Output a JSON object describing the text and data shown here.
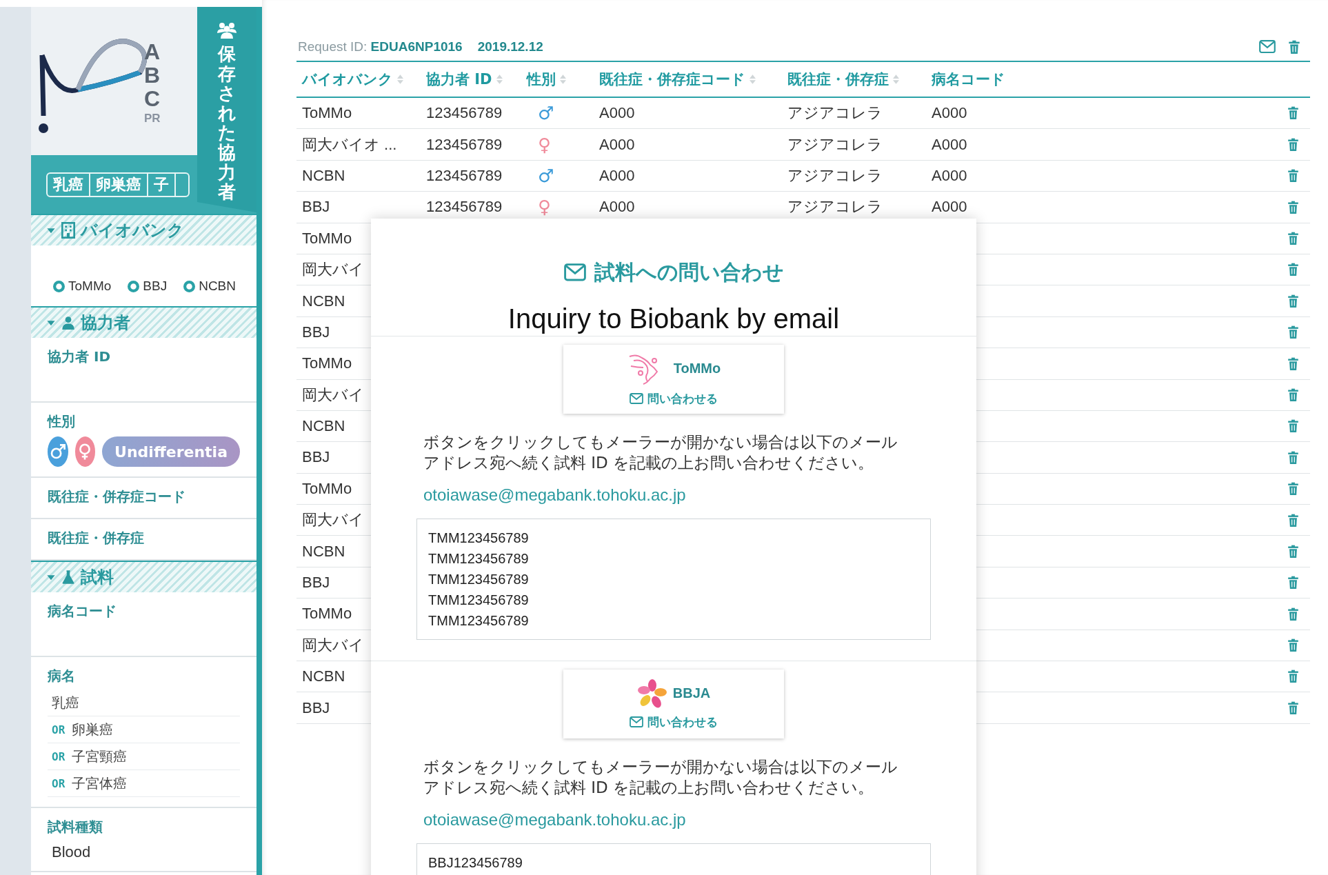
{
  "sidebar": {
    "logo_letters": [
      "A",
      "B",
      "C",
      "PR"
    ],
    "disease_tabs": [
      {
        "label": "乳癌"
      },
      {
        "label": "卵巣癌"
      },
      {
        "label": "子"
      }
    ],
    "sections": [
      {
        "title": "バイオバンク",
        "expanded": true,
        "fields": [
          {
            "kind": "chips",
            "options": [
              {
                "label": "ToMMo",
                "checked": true
              },
              {
                "label": "BBJ",
                "checked": true
              },
              {
                "label": "NCBN",
                "checked": true
              }
            ]
          }
        ]
      },
      {
        "title": "協力者",
        "expanded": true,
        "fields": [
          {
            "kind": "label",
            "label": "協力者 ID"
          },
          {
            "kind": "gender",
            "label": "性別",
            "options": [
              {
                "kind": "male"
              },
              {
                "kind": "female"
              },
              {
                "kind": "other",
                "label": "Undifferentia"
              }
            ]
          },
          {
            "kind": "label",
            "label": "既往症・併存症コード"
          },
          {
            "kind": "label",
            "label": "既往症・併存症"
          }
        ]
      },
      {
        "title": "試料",
        "expanded": true,
        "fields": [
          {
            "kind": "label",
            "label": "病名コード"
          },
          {
            "kind": "list",
            "label": "病名",
            "items": [
              {
                "text": "乳癌"
              },
              {
                "operator": "OR",
                "text": "卵巣癌"
              },
              {
                "operator": "OR",
                "text": "子宮頸癌"
              },
              {
                "operator": "OR",
                "text": "子宮体癌"
              }
            ]
          },
          {
            "kind": "value",
            "label": "試料種類",
            "value": "Blood"
          }
        ]
      }
    ]
  },
  "saved_tab": {
    "label": "保存された協力者"
  },
  "request": {
    "label": "Request ID:",
    "id": "EDUA6NP1016",
    "date": "2019.12.12"
  },
  "table": {
    "columns": [
      {
        "label": "バイオバンク",
        "sortable": true
      },
      {
        "label": "協力者 ID",
        "sortable": true
      },
      {
        "label": "性別",
        "sortable": true
      },
      {
        "label": "既往症・併存症コード",
        "sortable": true
      },
      {
        "label": "既往症・併存症",
        "sortable": true
      },
      {
        "label": "病名コード",
        "sortable": false
      }
    ],
    "rows": [
      {
        "biobank": "ToMMo",
        "donor_id": "123456789",
        "sex": {
          "symbol": "♂",
          "color": "#3a9ad8"
        },
        "code": "A000",
        "disease": "アジアコレラ",
        "disease_code": "A000"
      },
      {
        "biobank": "岡大バイオ ...",
        "donor_id": "123456789",
        "sex": {
          "symbol": "♀",
          "color": "#f08a9a"
        },
        "code": "A000",
        "disease": "アジアコレラ",
        "disease_code": "A000"
      },
      {
        "biobank": "NCBN",
        "donor_id": "123456789",
        "sex": {
          "symbol": "♂",
          "color": "#3a9ad8"
        },
        "code": "A000",
        "disease": "アジアコレラ",
        "disease_code": "A000"
      },
      {
        "biobank": "BBJ",
        "donor_id": "123456789",
        "sex": {
          "symbol": "♀",
          "color": "#f08a9a"
        },
        "code": "A000",
        "disease": "アジアコレラ",
        "disease_code": "A000"
      },
      {
        "biobank": "ToMMo"
      },
      {
        "biobank": "岡大バイ"
      },
      {
        "biobank": "NCBN"
      },
      {
        "biobank": "BBJ"
      },
      {
        "biobank": "ToMMo"
      },
      {
        "biobank": "岡大バイ"
      },
      {
        "biobank": "NCBN"
      },
      {
        "biobank": "BBJ"
      },
      {
        "biobank": "ToMMo"
      },
      {
        "biobank": "岡大バイ"
      },
      {
        "biobank": "NCBN"
      },
      {
        "biobank": "BBJ"
      },
      {
        "biobank": "ToMMo"
      },
      {
        "biobank": "岡大バイ"
      },
      {
        "biobank": "NCBN"
      },
      {
        "biobank": "BBJ"
      }
    ]
  },
  "modal": {
    "title": "試料への問い合わせ",
    "subtitle": "Inquiry to Biobank by email",
    "inquiries": [
      {
        "name": "ToMMo",
        "button": "問い合わせる",
        "note": "ボタンをクリックしてもメーラーが開かない場合は以下のメールアドレス宛へ続く試料 ID を記載の上お問い合わせください。",
        "email": "otoiawase@megabank.tohoku.ac.jp",
        "ids": [
          "TMM123456789",
          "TMM123456789",
          "TMM123456789",
          "TMM123456789",
          "TMM123456789"
        ]
      },
      {
        "name": "BBJA",
        "button": "問い合わせる",
        "note": "ボタンをクリックしてもメーラーが開かない場合は以下のメールアドレス宛へ続く試料 ID を記載の上お問い合わせください。",
        "email": "otoiawase@megabank.tohoku.ac.jp",
        "ids": [
          "BBJ123456789"
        ]
      }
    ]
  }
}
